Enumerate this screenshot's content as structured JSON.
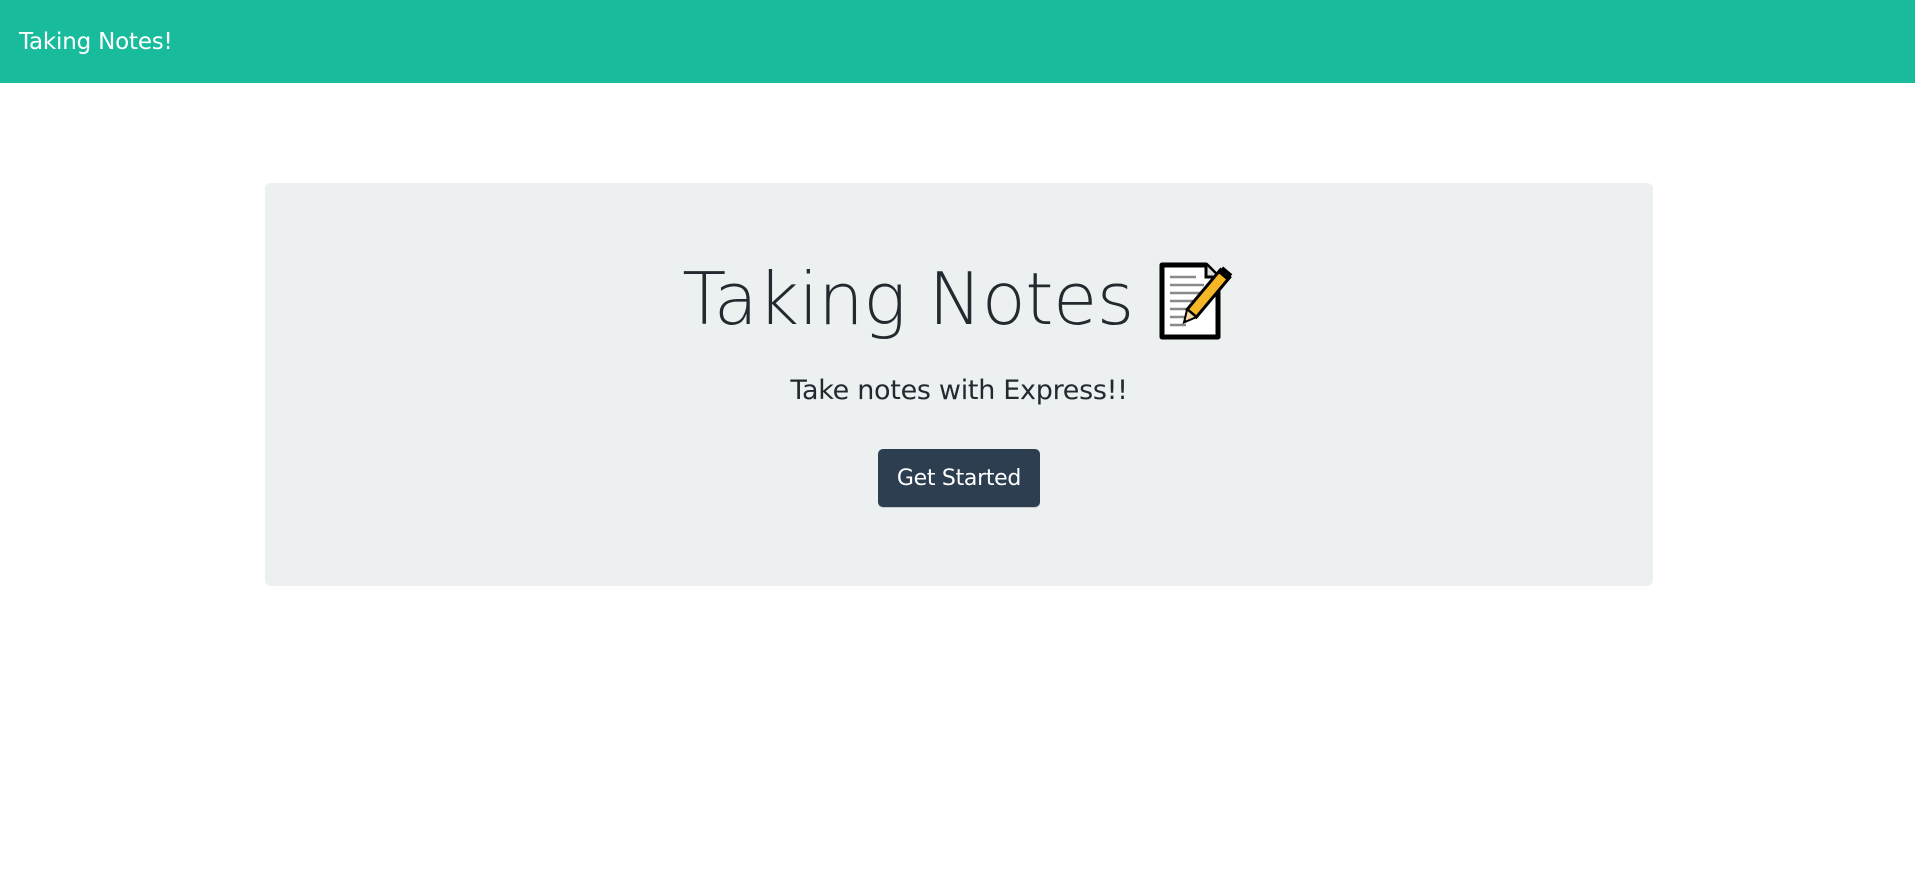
{
  "navbar": {
    "brand": "Taking Notes!",
    "background_color": "#18bc9c"
  },
  "hero": {
    "title": "Taking Notes",
    "title_icon": "memo-icon",
    "subtitle": "Take notes with Express!!",
    "cta_label": "Get Started",
    "cta_color": "#2c3e50",
    "panel_color": "#ecf0f1"
  }
}
